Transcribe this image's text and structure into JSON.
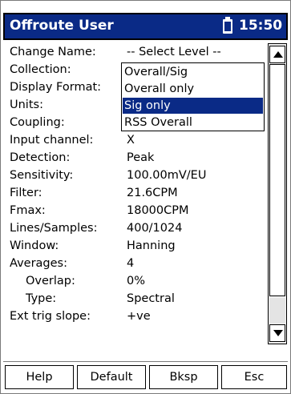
{
  "titlebar": {
    "title": "Offroute User",
    "time": "15:50"
  },
  "form": {
    "rows": [
      {
        "label": "Change Name:",
        "value": "-- Select Level --"
      },
      {
        "label": "Collection:",
        "value": ""
      },
      {
        "label": "Display Format:",
        "value": ""
      },
      {
        "label": "Units:",
        "value": ""
      },
      {
        "label": "Coupling:",
        "value": ""
      },
      {
        "label": "Input channel:",
        "value": "X"
      },
      {
        "label": "Detection:",
        "value": "Peak"
      },
      {
        "label": "Sensitivity:",
        "value": "100.00mV/EU"
      },
      {
        "label": "Filter:",
        "value": "21.6CPM"
      },
      {
        "label": "Fmax:",
        "value": "18000CPM"
      },
      {
        "label": "Lines/Samples:",
        "value": "400/1024"
      },
      {
        "label": "Window:",
        "value": "Hanning"
      },
      {
        "label": "Averages:",
        "value": "4"
      },
      {
        "label": "Overlap:",
        "value": "0%"
      },
      {
        "label": "Type:",
        "value": "Spectral"
      },
      {
        "label": "Ext trig slope:",
        "value": "+ve"
      }
    ]
  },
  "dropdown": {
    "options": [
      "Overall/Sig",
      "Overall only",
      "Sig only",
      "RSS Overall"
    ],
    "selected": "Sig only"
  },
  "buttons": {
    "help": "Help",
    "default": "Default",
    "bksp": "Bksp",
    "esc": "Esc"
  },
  "colors": {
    "titlebar": "#0a2a86",
    "selection": "#0a2a86"
  }
}
